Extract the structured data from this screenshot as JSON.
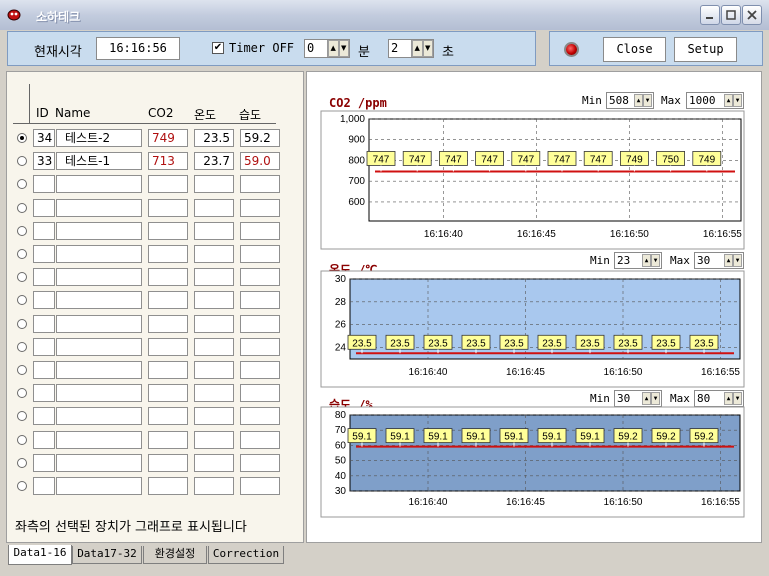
{
  "window": {
    "title": "소하테크"
  },
  "toolbar": {
    "now_label": "현재시각",
    "time_value": "16:16:56",
    "timer_label": "Timer OFF",
    "timer_checked": true,
    "minutes_value": "0",
    "minutes_unit": "분",
    "seconds_value": "2",
    "seconds_unit": "초",
    "close_label": "Close",
    "setup_label": "Setup"
  },
  "device_table": {
    "headers": {
      "id": "ID",
      "name": "Name",
      "co2": "CO2",
      "temp": "온도",
      "hum": "습도"
    },
    "rows": [
      {
        "selected": true,
        "id": "34",
        "name": "테스트-2",
        "co2": "749",
        "temp": "23.5",
        "hum": "59.2"
      },
      {
        "selected": false,
        "id": "33",
        "name": "테스트-1",
        "co2": "713",
        "temp": "23.7",
        "hum": "59.0"
      }
    ],
    "empty_rows": 14,
    "footer": "좌측의 선택된 장치가 그래프로 표시됩니다"
  },
  "tabs": [
    "Data1-16",
    "Data17-32",
    "환경설정",
    "Correction"
  ],
  "chart_data": [
    {
      "type": "line",
      "title": "CO2 /ppm",
      "min_label": "Min",
      "min_value": "508",
      "max_label": "Max",
      "max_value": "1000",
      "ylim": [
        508,
        1000
      ],
      "yticks": [
        "1,000",
        "900",
        "800",
        "700",
        "600"
      ],
      "xticks": [
        "16:16:40",
        "16:16:45",
        "16:16:50",
        "16:16:55"
      ],
      "line_value": 747,
      "data_labels": [
        "747",
        "747",
        "747",
        "747",
        "747",
        "747",
        "747",
        "749",
        "750",
        "749"
      ],
      "plot_bg": "#ffffff",
      "line_color": "#d01010"
    },
    {
      "type": "line",
      "title": "온도 /℃",
      "min_label": "Min",
      "min_value": "23",
      "max_label": "Max",
      "max_value": "30",
      "ylim": [
        23,
        30
      ],
      "yticks": [
        "30",
        "28",
        "26",
        "24"
      ],
      "xticks": [
        "16:16:40",
        "16:16:45",
        "16:16:50",
        "16:16:55"
      ],
      "line_value": 23.5,
      "data_labels": [
        "23.5",
        "23.5",
        "23.5",
        "23.5",
        "23.5",
        "23.5",
        "23.5",
        "23.5",
        "23.5",
        "23.5"
      ],
      "plot_bg": "#a9c8ee",
      "line_color": "#d01010"
    },
    {
      "type": "line",
      "title": "습도 /%",
      "min_label": "Min",
      "min_value": "30",
      "max_label": "Max",
      "max_value": "80",
      "ylim": [
        30,
        80
      ],
      "yticks": [
        "80",
        "70",
        "60",
        "50",
        "40",
        "30"
      ],
      "xticks": [
        "16:16:40",
        "16:16:45",
        "16:16:50",
        "16:16:55"
      ],
      "line_value": 59.2,
      "data_labels": [
        "59.1",
        "59.1",
        "59.1",
        "59.1",
        "59.1",
        "59.1",
        "59.1",
        "59.2",
        "59.2",
        "59.2"
      ],
      "plot_bg": "#7f9fc9",
      "line_color": "#d01010"
    }
  ]
}
